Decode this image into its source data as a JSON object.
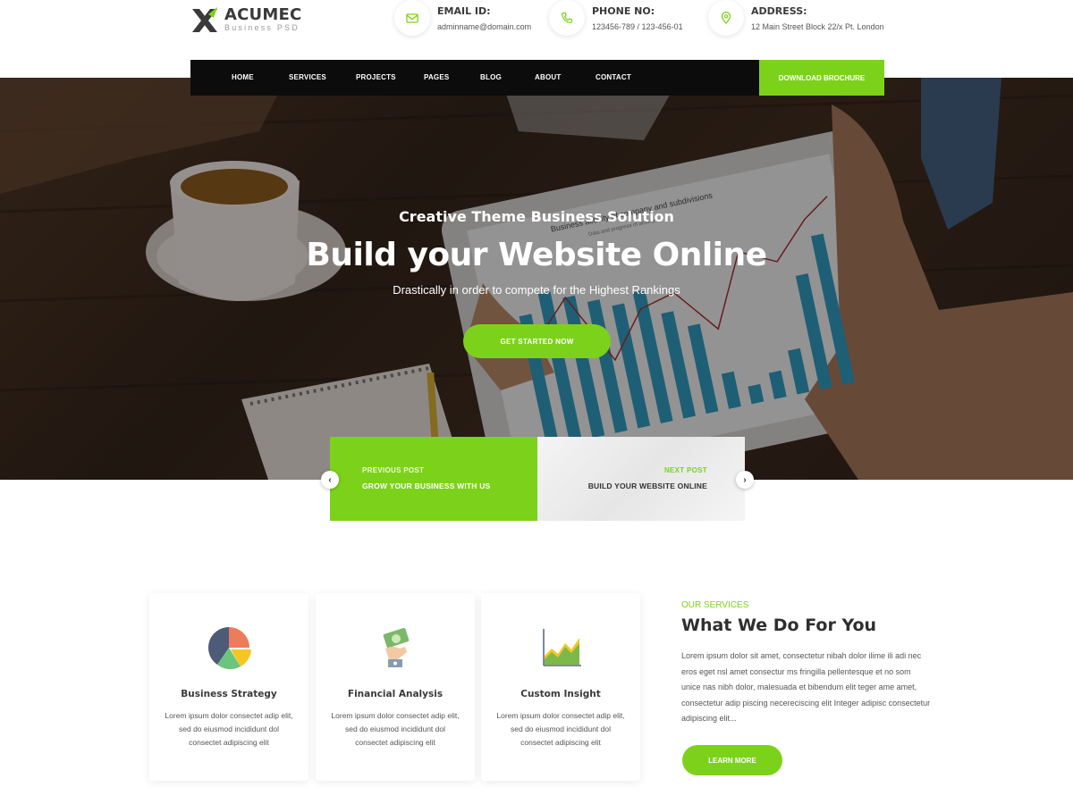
{
  "brand": {
    "name": "ACUMEC",
    "tagline": "Business PSD"
  },
  "contacts": [
    {
      "title": "EMAIL ID:",
      "value": "adminname@domain.com",
      "icon": "envelope-icon"
    },
    {
      "title": "PHONE NO:",
      "value": "123456-789 / 123-456-01",
      "icon": "phone-icon"
    },
    {
      "title": "ADDRESS:",
      "value": "12 Main Street Block 22/x Pt. London",
      "icon": "location-pin-icon"
    }
  ],
  "nav": {
    "items": [
      "HOME",
      "SERVICES",
      "PROJECTS",
      "PAGES",
      "BLOG",
      "ABOUT",
      "CONTACT"
    ],
    "cta": "DOWNLOAD BROCHURE"
  },
  "hero": {
    "kicker": "Creative Theme Business Solution",
    "title": "Build your Website Online",
    "subtitle": "Drastically in order to compete for the Highest Rankings",
    "button": "GET STARTED NOW",
    "tablet_chart": {
      "title": "Business activity of company and subdivisions",
      "subtitle": "Data and progress of activity"
    }
  },
  "post_nav": {
    "prev": {
      "label": "PREVIOUS POST",
      "title": "GROW YOUR BUSINESS WITH US",
      "arrow": "‹"
    },
    "next": {
      "label": "NEXT POST",
      "title": "BUILD YOUR WEBSITE ONLINE",
      "arrow": "›"
    }
  },
  "services": {
    "cards": [
      {
        "title": "Business Strategy",
        "text": "Lorem ipsum dolor consectet adip elit, sed do eiusmod incididunt dol consectet adipiscing elit",
        "icon": "pie-chart-icon"
      },
      {
        "title": "Financial Analysis",
        "text": "Lorem ipsum dolor consectet adip elit, sed do eiusmod incididunt dol consectet adipiscing elit",
        "icon": "money-hand-icon"
      },
      {
        "title": "Custom Insight",
        "text": "Lorem ipsum dolor consectet adip elit, sed do eiusmod incididunt dol consectet adipiscing elit",
        "icon": "area-chart-icon"
      }
    ],
    "kicker": "OUR SERVICES",
    "title": "What We Do For You",
    "body": "Lorem ipsum dolor sit amet, consectetur nibah dolor ilime ili adi nec eros eget nsl  amet consectur ms fringilla pellentesque et no som unice nas nibh dolor, malesuada et bibendum elit teger ame amet, consectetur adip piscing necereciscing elit Integer adipisc consectetur adipiscing elit...",
    "button": "LEARN MORE"
  },
  "colors": {
    "accent": "#7cd21a",
    "nav_bg": "#0c0c0c",
    "heading": "#2f2f2f"
  }
}
